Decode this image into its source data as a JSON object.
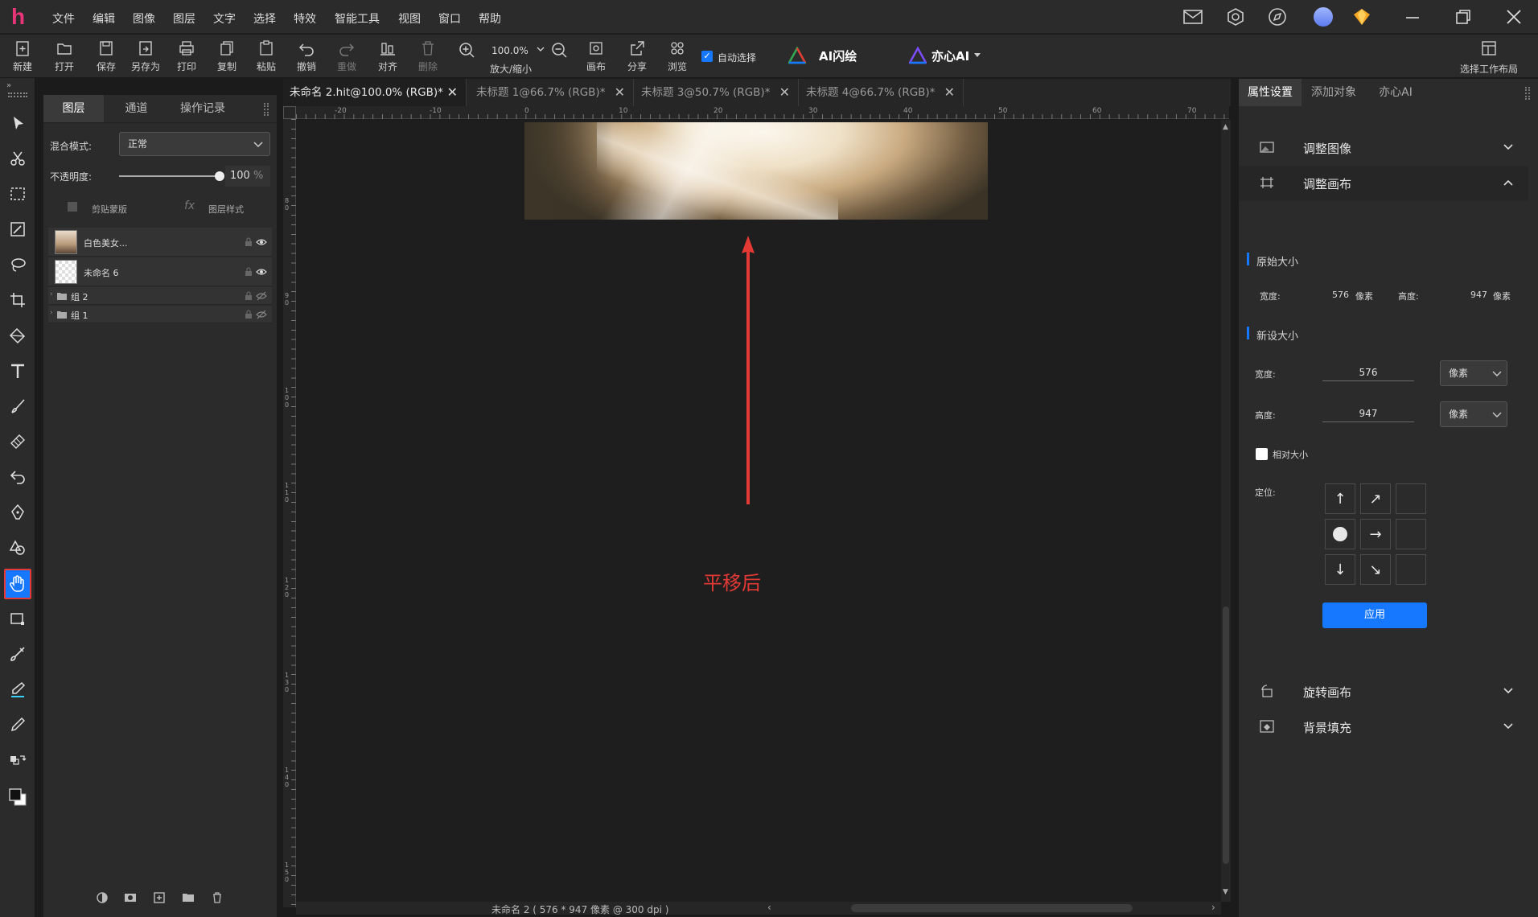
{
  "menubar": {
    "items": [
      "文件",
      "编辑",
      "图像",
      "图层",
      "文字",
      "选择",
      "特效",
      "智能工具",
      "视图",
      "窗口",
      "帮助"
    ]
  },
  "toolbar": {
    "new": "新建",
    "open": "打开",
    "save": "保存",
    "save_as": "另存为",
    "print": "打印",
    "copy": "复制",
    "paste": "粘贴",
    "undo": "撤销",
    "redo": "重做",
    "align": "对齐",
    "delete": "删除",
    "zoom_value": "100.0%",
    "zoom_label": "放大/缩小",
    "canvas": "画布",
    "share": "分享",
    "browse": "浏览",
    "auto_select": "自动选择",
    "ai_draw": "AI闪绘",
    "yixin_ai": "亦心AI",
    "workspace": "选择工作布局"
  },
  "layers_panel": {
    "tabs": [
      "图层",
      "通道",
      "操作记录"
    ],
    "blend_label": "混合模式:",
    "blend_value": "正常",
    "opacity_label": "不透明度:",
    "opacity_value": "100",
    "opacity_unit": "%",
    "opacity_level": 1.0,
    "clip_mask": "剪贴蒙版",
    "layer_style": "图层样式",
    "layers": [
      {
        "name": "白色美女...",
        "type": "image"
      },
      {
        "name": "未命名 6",
        "type": "image"
      },
      {
        "name": "组 2",
        "type": "group"
      },
      {
        "name": "组 1",
        "type": "group"
      }
    ]
  },
  "doc_tabs": [
    {
      "title": "未命名 2.hit@100.0% (RGB)*",
      "active": true
    },
    {
      "title": "未标题 1@66.7% (RGB)*",
      "active": false
    },
    {
      "title": "未标题 3@50.7% (RGB)*",
      "active": false
    },
    {
      "title": "未标题 4@66.7% (RGB)*",
      "active": false
    }
  ],
  "ruler": {
    "top_labels": [
      "-20",
      "-10",
      "0",
      "10",
      "20",
      "30",
      "40",
      "50",
      "60",
      "70"
    ],
    "left_labels": [
      "7",
      "0",
      "8",
      "0",
      "9",
      "0",
      "1",
      "0",
      "0",
      "1",
      "1",
      "0",
      "1",
      "2",
      "0",
      "1",
      "3",
      "0",
      "1",
      "4",
      "0",
      "1",
      "5",
      "0"
    ]
  },
  "canvas": {
    "annotation": "平移后",
    "status": "未命名 2 ( 576 * 947 像素 @ 300 dpi )"
  },
  "props_panel": {
    "tabs": [
      "属性设置",
      "添加对象",
      "亦心AI"
    ],
    "adjust_image": "调整图像",
    "adjust_canvas": "调整画布",
    "original_size": "原始大小",
    "orig_width_label": "宽度:",
    "orig_width": "576",
    "orig_unit": "像素",
    "orig_height_label": "高度:",
    "orig_height": "947",
    "new_size": "新设大小",
    "width_label": "宽度:",
    "width_value": "576",
    "width_unit": "像素",
    "height_label": "高度:",
    "height_value": "947",
    "height_unit": "像素",
    "relative": "相对大小",
    "anchor_label": "定位:",
    "apply": "应用",
    "rotate_canvas": "旋转画布",
    "bg_fill": "背景填充"
  },
  "colors": {
    "accent": "#1677ff",
    "annotation": "#e53935",
    "highlight_border": "#e53935"
  }
}
